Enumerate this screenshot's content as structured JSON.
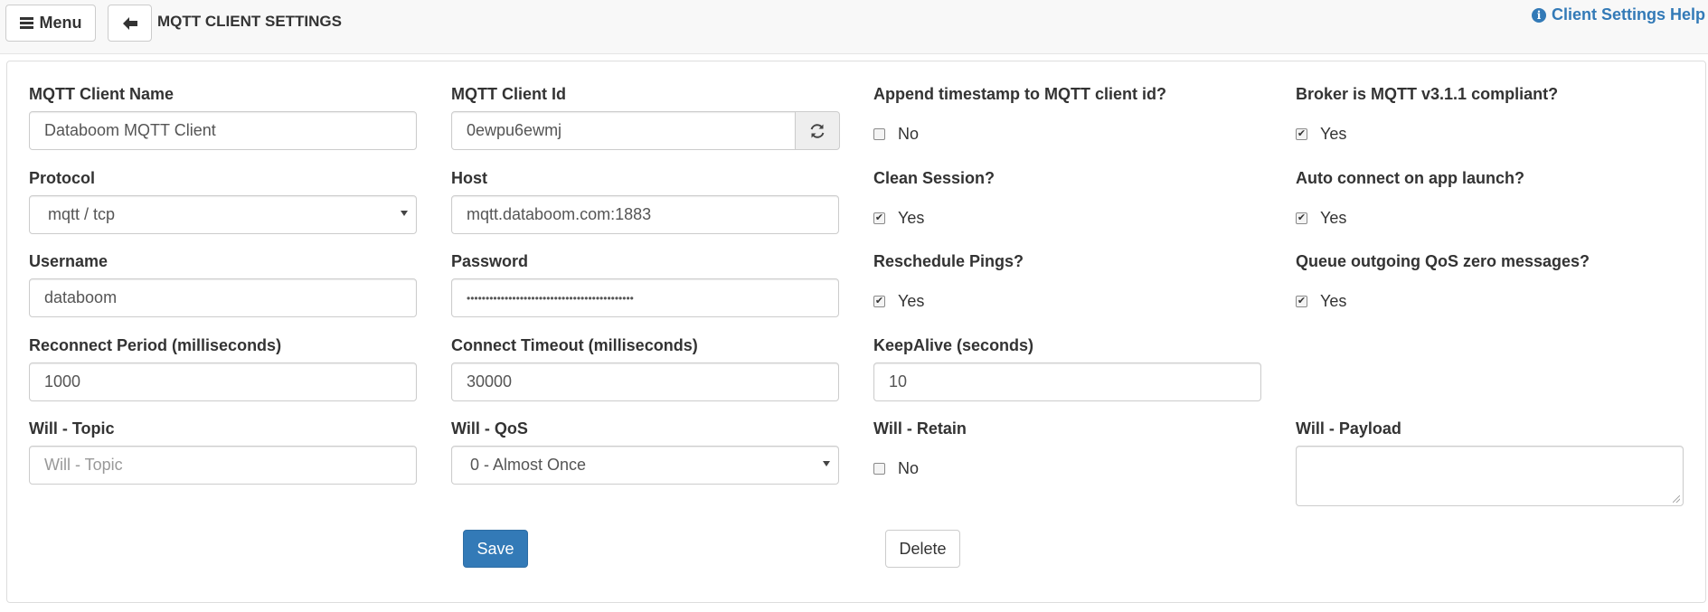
{
  "header": {
    "menu_label": "Menu",
    "back_icon": "arrow-left-icon",
    "title": "MQTT CLIENT SETTINGS",
    "help_label": "Client Settings Help",
    "help_icon": "info-circle-icon"
  },
  "form": {
    "client_name": {
      "label": "MQTT Client Name",
      "value": "Databoom MQTT Client"
    },
    "client_id": {
      "label": "MQTT Client Id",
      "value": "0ewpu6ewmj",
      "refresh_icon": "refresh-icon"
    },
    "append_timestamp": {
      "label": "Append timestamp to MQTT client id?",
      "checked": false,
      "option": "No"
    },
    "broker_v311": {
      "label": "Broker is MQTT v3.1.1 compliant?",
      "checked": true,
      "option": "Yes"
    },
    "protocol": {
      "label": "Protocol",
      "value": "mqtt / tcp"
    },
    "host": {
      "label": "Host",
      "value": "mqtt.databoom.com:1883"
    },
    "clean_session": {
      "label": "Clean Session?",
      "checked": true,
      "option": "Yes"
    },
    "auto_connect": {
      "label": "Auto connect on app launch?",
      "checked": true,
      "option": "Yes"
    },
    "username": {
      "label": "Username",
      "value": "databoom"
    },
    "password": {
      "label": "Password",
      "value": "••••••••••••••••••••••••••••••••••••••••••••"
    },
    "reschedule_pings": {
      "label": "Reschedule Pings?",
      "checked": true,
      "option": "Yes"
    },
    "queue_qos_zero": {
      "label": "Queue outgoing QoS zero messages?",
      "checked": true,
      "option": "Yes"
    },
    "reconnect_period": {
      "label": "Reconnect Period (milliseconds)",
      "value": "1000"
    },
    "connect_timeout": {
      "label": "Connect Timeout (milliseconds)",
      "value": "30000"
    },
    "keepalive": {
      "label": "KeepAlive (seconds)",
      "value": "10"
    },
    "will_topic": {
      "label": "Will - Topic",
      "value": "",
      "placeholder": "Will - Topic"
    },
    "will_qos": {
      "label": "Will - QoS",
      "value": "0 - Almost Once"
    },
    "will_retain": {
      "label": "Will - Retain",
      "checked": false,
      "option": "No"
    },
    "will_payload": {
      "label": "Will - Payload",
      "value": ""
    }
  },
  "actions": {
    "save_label": "Save",
    "delete_label": "Delete"
  },
  "colors": {
    "primary": "#337ab7",
    "border": "#cccccc",
    "topbar_bg": "#f8f8f8"
  }
}
